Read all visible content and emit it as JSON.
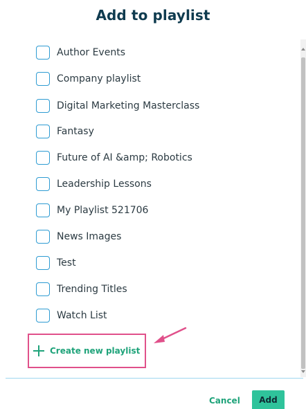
{
  "dialog": {
    "title": "Add to playlist"
  },
  "playlists": [
    {
      "label": "Author Events",
      "checked": false
    },
    {
      "label": "Company playlist",
      "checked": false
    },
    {
      "label": "Digital Marketing Masterclass",
      "checked": false
    },
    {
      "label": "Fantasy",
      "checked": false
    },
    {
      "label": "Future of AI &amp; Robotics",
      "checked": false
    },
    {
      "label": "Leadership Lessons",
      "checked": false
    },
    {
      "label": "My Playlist 521706",
      "checked": false
    },
    {
      "label": "News Images",
      "checked": false
    },
    {
      "label": "Test",
      "checked": false
    },
    {
      "label": "Trending Titles",
      "checked": false
    },
    {
      "label": "Watch List",
      "checked": false
    }
  ],
  "create": {
    "label": "Create new playlist",
    "icon": "plus-icon"
  },
  "footer": {
    "cancel_label": "Cancel",
    "add_label": "Add"
  },
  "colors": {
    "title": "#0f3b4f",
    "accent_green": "#1fa37a",
    "add_button": "#2fc39b",
    "checkbox_border": "#2d9bd2",
    "highlight_box": "#e0508a"
  }
}
